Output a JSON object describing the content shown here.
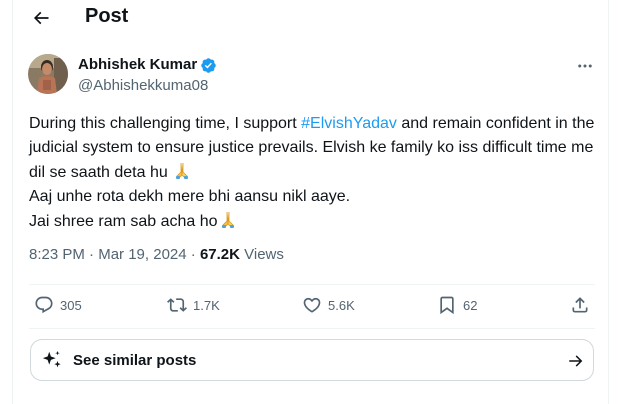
{
  "header": {
    "title": "Post"
  },
  "author": {
    "name": "Abhishek Kumar",
    "handle": "@Abhishekkuma08",
    "verified": true,
    "verified_color": "#1d9bf0"
  },
  "tweet": {
    "line1_pre": "During this challenging time, I support ",
    "hashtag": "#ElvishYadav",
    "line1_post": " and remain confident in the judicial system to ensure justice prevails. Elvish ke family ko iss difficult time me dil se saath deta hu",
    "line2": "Aaj unhe rota dekh mere bhi aansu nikl aaye.",
    "line3": "Jai shree ram sab acha ho",
    "emoji_icon": "folded-hands-icon"
  },
  "meta": {
    "time": "8:23 PM",
    "separator": " · ",
    "date": "Mar 19, 2024",
    "views_count": "67.2K",
    "views_label": " Views"
  },
  "actions": {
    "replies": "305",
    "reposts": "1.7K",
    "likes": "5.6K",
    "bookmarks": "62"
  },
  "similar": {
    "label": "See similar posts"
  },
  "colors": {
    "text": "#0f1419",
    "secondary": "#536471",
    "accent": "#1d9bf0",
    "border": "#cfd9de"
  }
}
